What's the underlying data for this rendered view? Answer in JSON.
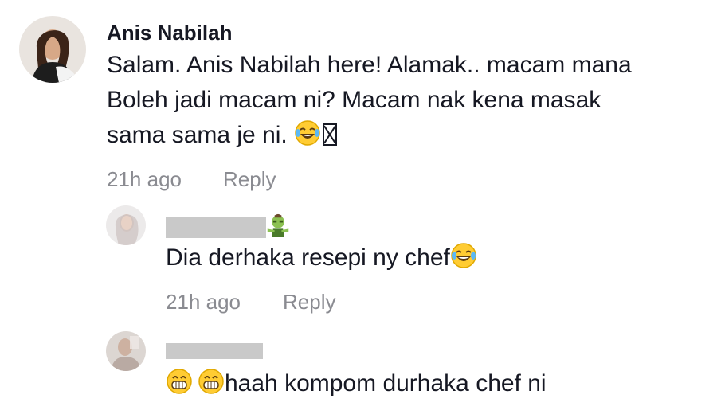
{
  "comments": [
    {
      "username": "Anis Nabilah",
      "text_line1": "Salam. Anis Nabilah here! Alamak.. macam mana",
      "text_line2": "Boleh jadi macam ni? Macam nak kena masak",
      "text_line3": "sama sama je ni.",
      "time": "21h ago",
      "reply_label": "Reply",
      "emojis": [
        "tears-of-joy-emoji",
        "missing-glyph-icon"
      ]
    },
    {
      "username": "",
      "username_redacted": true,
      "username_emoji": "zombie-emoji",
      "text": "Dia derhaka resepi ny chef",
      "time": "21h ago",
      "reply_label": "Reply",
      "emojis": [
        "tears-of-joy-emoji"
      ]
    },
    {
      "username": "",
      "username_redacted": true,
      "text": "haah kompom durhaka chef ni",
      "emojis": [
        "grinning-face-emoji",
        "grinning-face-emoji"
      ]
    }
  ],
  "colors": {
    "text": "#161823",
    "meta": "#8a8b91",
    "redaction": "#c9c9c9"
  }
}
